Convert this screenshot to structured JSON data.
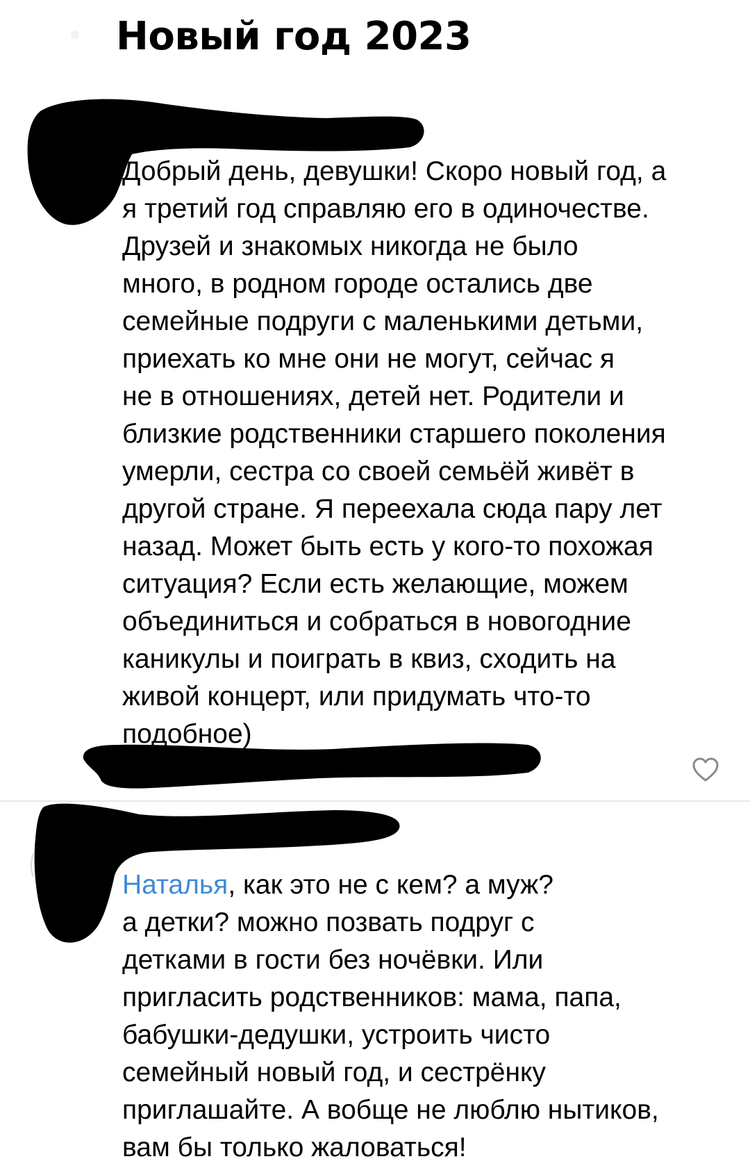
{
  "page": {
    "title": "Новый год 2023"
  },
  "comments": [
    {
      "lines": [
        "Добрый день, девушки! Скоро новый год, а",
        "я третий год справляю его в одиночестве.",
        "Друзей и знакомых никогда не было",
        "много, в родном городе остались две",
        "семейные подруги с маленькими детьми,",
        "приехать ко мне они не могут, сейчас я",
        "не в отношениях, детей нет. Родители и",
        "близкие родственники старшего поколения",
        "умерли, сестра со своей семьёй живёт в",
        "другой стране. Я переехала сюда пару лет",
        "назад. Может быть есть у кого-то похожая",
        "ситуация? Если есть желающие, можем",
        "объединиться и собраться в новогодние",
        "каникулы и поиграть в квиз, сходить на",
        "живой концерт, или придумать что-то",
        "подобное)"
      ]
    },
    {
      "mention": "Наталья",
      "first_line_rest": ", как это не с кем? а муж?",
      "lines": [
        "а детки? можно позвать подруг с",
        "детками в гости без ночёвки. Или",
        "пригласить родственников: мама, папа,",
        "бабушки-дедушки, устроить  чисто",
        "семейный новый год, и сестрёнку",
        "приглашайте. А вобще не люблю нытиков,",
        "вам бы только жаловаться!"
      ]
    }
  ],
  "icons": {
    "like": "heart-outline-icon"
  },
  "colors": {
    "mention": "#3f8ad6",
    "redaction": "#000000",
    "divider": "#e6e6e6",
    "heart": "#8a8a8a"
  }
}
